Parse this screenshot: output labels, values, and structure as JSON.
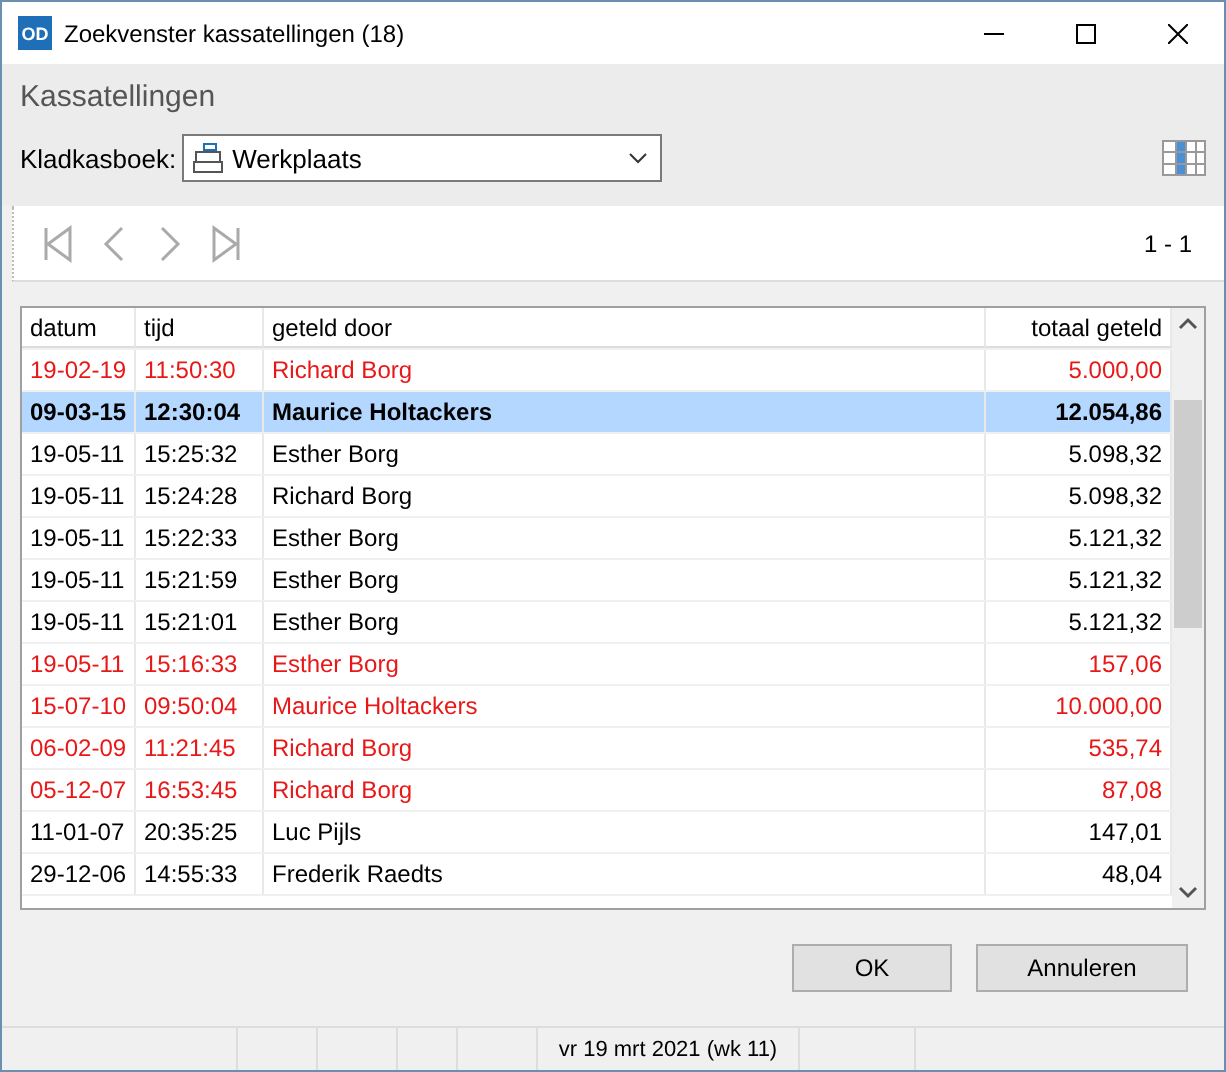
{
  "window": {
    "app_badge": "OD",
    "title": "Zoekvenster kassatellingen (18)"
  },
  "header": {
    "title": "Kassatellingen"
  },
  "cashbook": {
    "label": "Kladkasboek:",
    "value": "Werkplaats"
  },
  "navigation": {
    "page_count": "1 - 1"
  },
  "table": {
    "columns": [
      "datum",
      "tijd",
      "geteld door",
      "totaal geteld"
    ],
    "rows": [
      {
        "cells": [
          "19-02-19",
          "11:50:30",
          "Richard Borg",
          "5.000,00"
        ],
        "flagged": true,
        "selected": false
      },
      {
        "cells": [
          "09-03-15",
          "12:30:04",
          "Maurice Holtackers",
          "12.054,86"
        ],
        "flagged": false,
        "selected": true
      },
      {
        "cells": [
          "19-05-11",
          "15:25:32",
          "Esther Borg",
          "5.098,32"
        ],
        "flagged": false,
        "selected": false
      },
      {
        "cells": [
          "19-05-11",
          "15:24:28",
          "Richard Borg",
          "5.098,32"
        ],
        "flagged": false,
        "selected": false
      },
      {
        "cells": [
          "19-05-11",
          "15:22:33",
          "Esther Borg",
          "5.121,32"
        ],
        "flagged": false,
        "selected": false
      },
      {
        "cells": [
          "19-05-11",
          "15:21:59",
          "Esther Borg",
          "5.121,32"
        ],
        "flagged": false,
        "selected": false
      },
      {
        "cells": [
          "19-05-11",
          "15:21:01",
          "Esther Borg",
          "5.121,32"
        ],
        "flagged": false,
        "selected": false
      },
      {
        "cells": [
          "19-05-11",
          "15:16:33",
          "Esther Borg",
          "157,06"
        ],
        "flagged": true,
        "selected": false
      },
      {
        "cells": [
          "15-07-10",
          "09:50:04",
          "Maurice Holtackers",
          "10.000,00"
        ],
        "flagged": true,
        "selected": false
      },
      {
        "cells": [
          "06-02-09",
          "11:21:45",
          "Richard Borg",
          "535,74"
        ],
        "flagged": true,
        "selected": false
      },
      {
        "cells": [
          "05-12-07",
          "16:53:45",
          "Richard Borg",
          "87,08"
        ],
        "flagged": true,
        "selected": false
      },
      {
        "cells": [
          "11-01-07",
          "20:35:25",
          "Luc Pijls",
          "147,01"
        ],
        "flagged": false,
        "selected": false
      },
      {
        "cells": [
          "29-12-06",
          "14:55:33",
          "Frederik Raedts",
          "48,04"
        ],
        "flagged": false,
        "selected": false
      }
    ]
  },
  "buttons": [
    "OK",
    "Annuleren"
  ],
  "status_bar": {
    "date": "vr 19 mrt 2021 (wk 11)"
  }
}
